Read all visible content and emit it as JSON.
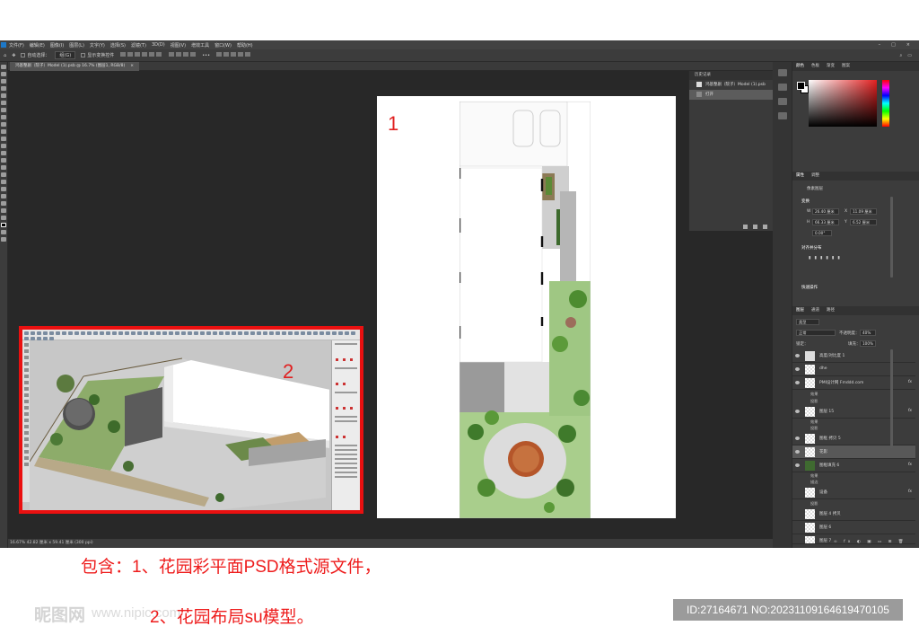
{
  "menubar": {
    "items": [
      "文件(F)",
      "编辑(E)",
      "图像(I)",
      "图层(L)",
      "文字(Y)",
      "选择(S)",
      "滤镜(T)",
      "3D(D)",
      "视图(V)",
      "增效工具",
      "窗口(W)",
      "帮助(H)"
    ]
  },
  "options_bar": {
    "auto_select": "自动选择：",
    "group_value": "组(G)",
    "show_transform": "显示变换控件"
  },
  "document_tab": {
    "title": "鸿基整剧（院子）Model (1).psb @ 16.7% (图层1, RGB/8)",
    "close": "×"
  },
  "status_bar": {
    "text": "16.67%   42.82 厘米 x 59.41 厘米 (300 ppi)"
  },
  "doc_labels": {
    "one": "1",
    "two": "2"
  },
  "history_panel": {
    "title": "历史记录",
    "snapshot": "鸿基整剧（院子）Model (1).psb",
    "step": "打开"
  },
  "panels": {
    "color_tabs": [
      "颜色",
      "色板",
      "渐变",
      "图案"
    ],
    "properties_tabs": [
      "属性",
      "调整"
    ],
    "properties_type": "像素图层",
    "transform_title": "变换",
    "w_label": "W",
    "w_value": "26.40 厘米",
    "x_label": "X",
    "x_value": "11.09 厘米",
    "h_label": "H",
    "h_value": "66.33 厘米",
    "y_label": "Y",
    "y_value": "6.52 厘米",
    "angle_value": "0.00°",
    "align_title": "对齐并分布",
    "quick_actions": "快速操作",
    "layers_tabs": [
      "图层",
      "通道",
      "路径"
    ],
    "kind": "类型",
    "blend_mode": "正常",
    "opacity_label": "不透明度：",
    "opacity_value": "40%",
    "lock_label": "锁定：",
    "fill_label": "填充：",
    "fill_value": "100%"
  },
  "layers": [
    {
      "name": "高度/对比度 1",
      "fx": ""
    },
    {
      "name": "dhe",
      "fx": ""
    },
    {
      "name": "PMI设计网 Fmddd.com",
      "fx": "fx"
    },
    {
      "name": "图层 15",
      "fx": "fx"
    },
    {
      "name": "图框 拷贝 5",
      "fx": ""
    },
    {
      "name": "花影",
      "fx": ""
    },
    {
      "name": "图框填充 6",
      "fx": "fx"
    },
    {
      "name": "设备",
      "fx": "fx"
    },
    {
      "name": "图层 4 拷贝",
      "fx": ""
    },
    {
      "name": "图层 6",
      "fx": ""
    },
    {
      "name": "图层 7",
      "fx": ""
    }
  ],
  "layer_subs": {
    "effects": "效果",
    "shadow": "投影",
    "stroke": "描边"
  },
  "caption": {
    "line1": "包含：1、花园彩平面PSD格式源文件，",
    "line2": "2、花园布局su模型。"
  },
  "watermark": {
    "logo": "昵图网",
    "url": "www.nipic.com"
  },
  "id_box": {
    "text": "ID:27164671 NO:20231109164619470105"
  }
}
